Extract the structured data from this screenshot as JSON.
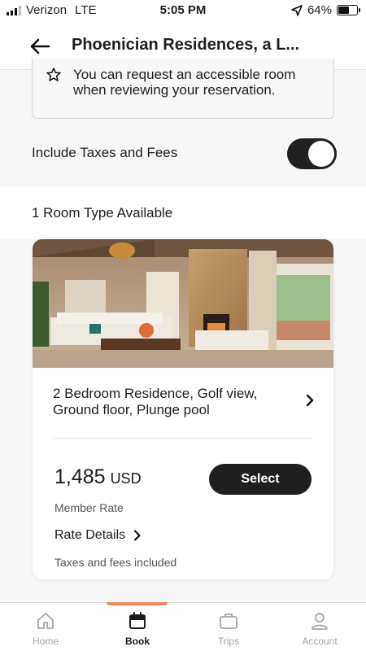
{
  "status_bar": {
    "carrier": "Verizon",
    "network": "LTE",
    "time": "5:05 PM",
    "battery_percent": "64%",
    "battery_level": 0.64
  },
  "header": {
    "title": "Phoenician Residences, a L...",
    "back_icon": "arrow-left-icon"
  },
  "notice": {
    "icon": "star-icon",
    "text": "You can request an accessible room when reviewing your reservation."
  },
  "taxes_toggle": {
    "label": "Include Taxes and Fees",
    "on": true
  },
  "room_count": "1 Room Type Available",
  "room": {
    "name": "2 Bedroom Residence, Golf view, Ground floor, Plunge pool",
    "price": "1,485",
    "currency": "USD",
    "select_label": "Select",
    "rate_type": "Member Rate",
    "rate_details": "Rate Details",
    "tax_note": "Taxes and fees included"
  },
  "tabs": [
    {
      "label": "Home",
      "icon": "home-icon",
      "active": false
    },
    {
      "label": "Book",
      "icon": "calendar-icon",
      "active": true
    },
    {
      "label": "Trips",
      "icon": "briefcase-icon",
      "active": false
    },
    {
      "label": "Account",
      "icon": "user-icon",
      "active": false
    }
  ],
  "colors": {
    "accent": "#f08a5d",
    "dark": "#1f1f1f"
  }
}
